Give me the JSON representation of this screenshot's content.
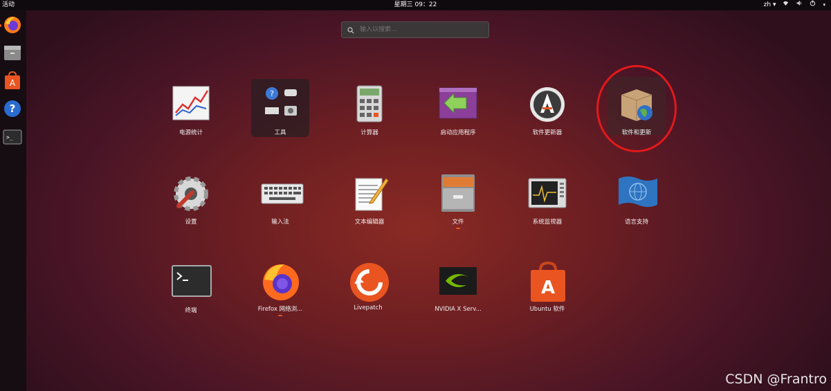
{
  "topbar": {
    "activities": "活动",
    "clock": "星期三 09：22",
    "lang": "zh ▾",
    "icons": [
      "network-icon",
      "volume-icon",
      "power-icon"
    ]
  },
  "dock": {
    "items": [
      "firefox-icon",
      "files-icon",
      "software-center-icon",
      "help-icon",
      "terminal-icon"
    ]
  },
  "search": {
    "placeholder": "输入以搜索..."
  },
  "apps": [
    {
      "name": "power-statistics",
      "label": "电源统计"
    },
    {
      "name": "tools",
      "label": "工具"
    },
    {
      "name": "calculator",
      "label": "计算器"
    },
    {
      "name": "startup-applications",
      "label": "启动应用程序"
    },
    {
      "name": "software-updater",
      "label": "软件更新器"
    },
    {
      "name": "software-and-updates",
      "label": "软件和更新"
    },
    {
      "name": "settings",
      "label": "设置"
    },
    {
      "name": "input-method",
      "label": "输入法"
    },
    {
      "name": "text-editor",
      "label": "文本编辑器"
    },
    {
      "name": "files",
      "label": "文件"
    },
    {
      "name": "system-monitor",
      "label": "系统监视器"
    },
    {
      "name": "language-support",
      "label": "语言支持"
    },
    {
      "name": "terminal",
      "label": "终端"
    },
    {
      "name": "firefox",
      "label": "Firefox 网络浏..."
    },
    {
      "name": "livepatch",
      "label": "Livepatch"
    },
    {
      "name": "nvidia-settings",
      "label": "NVIDIA X Serv..."
    },
    {
      "name": "ubuntu-software",
      "label": "Ubuntu 软件"
    }
  ],
  "watermark": "CSDN @Frantro",
  "colors": {
    "accent": "#e95420",
    "highlight_circle": "#e3191b"
  }
}
